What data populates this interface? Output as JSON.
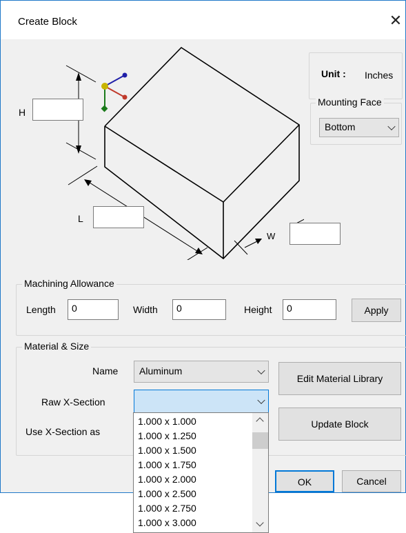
{
  "dialog": {
    "title": "Create Block",
    "close_icon": "close-icon"
  },
  "unit": {
    "label": "Unit :",
    "value": "Inches"
  },
  "mounting_face": {
    "legend": "Mounting Face",
    "selected": "Bottom"
  },
  "dimensions": {
    "h_label": "H",
    "l_label": "L",
    "w_label": "W",
    "h_value": "",
    "l_value": "",
    "w_value": ""
  },
  "machining": {
    "legend": "Machining Allowance",
    "length_label": "Length",
    "length_value": "0",
    "width_label": "Width",
    "width_value": "0",
    "height_label": "Height",
    "height_value": "0",
    "apply_label": "Apply"
  },
  "material": {
    "legend": "Material & Size",
    "name_label": "Name",
    "name_value": "Aluminum",
    "raw_label": "Raw X-Section",
    "raw_value": "",
    "use_label": "Use X-Section as",
    "edit_library_label": "Edit Material Library",
    "update_block_label": "Update Block"
  },
  "xsection_options": [
    "1.000 x 1.000",
    "1.000 x 1.250",
    "1.000 x 1.500",
    "1.000 x 1.750",
    "1.000 x 2.000",
    "1.000 x 2.500",
    "1.000 x 2.750",
    "1.000 x 3.000"
  ],
  "footer": {
    "ok_label": "OK",
    "cancel_label": "Cancel"
  },
  "colors": {
    "accent": "#0078d7",
    "combo_focus": "#cce4f7",
    "axis_x": "#c0392b",
    "axis_y": "#1a7a1a",
    "axis_z": "#1f1fa8"
  }
}
